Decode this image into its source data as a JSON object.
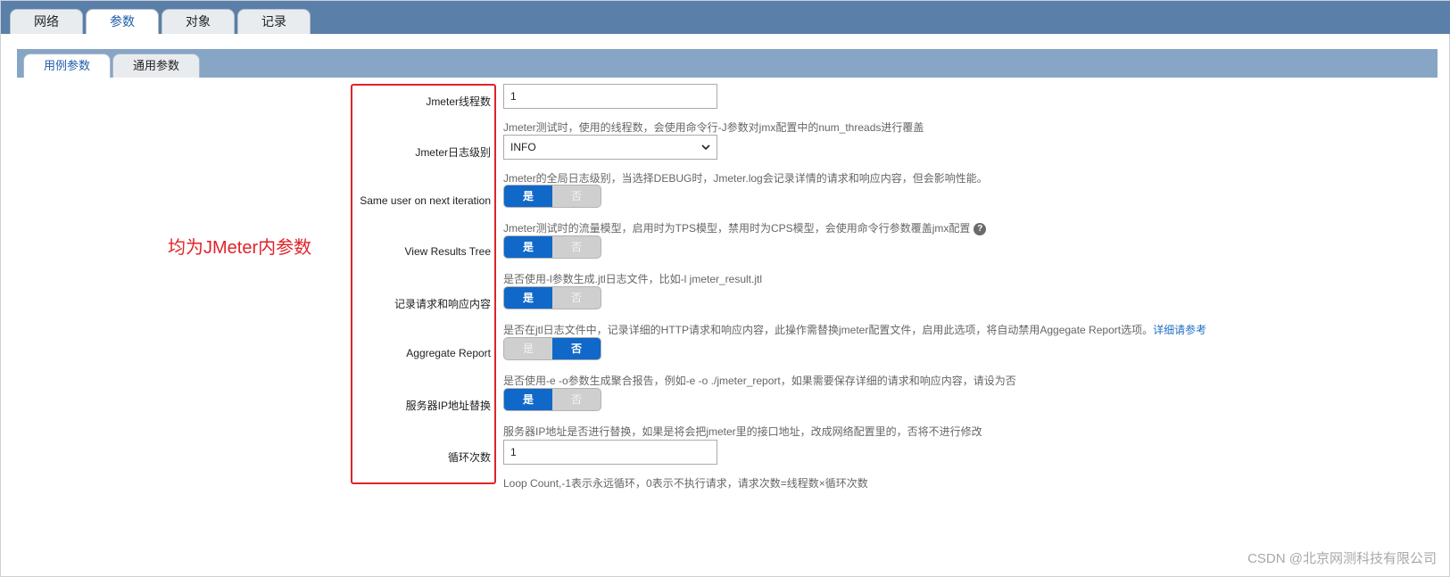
{
  "top_tabs": [
    {
      "label": "网络",
      "active": false
    },
    {
      "label": "参数",
      "active": true
    },
    {
      "label": "对象",
      "active": false
    },
    {
      "label": "记录",
      "active": false
    }
  ],
  "sub_tabs": [
    {
      "label": "用例参数",
      "active": true
    },
    {
      "label": "通用参数",
      "active": false
    }
  ],
  "form": {
    "threads": {
      "label": "Jmeter线程数",
      "value": "1",
      "help": "Jmeter测试时，使用的线程数，会使用命令行-J参数对jmx配置中的num_threads进行覆盖"
    },
    "log_level": {
      "label": "Jmeter日志级别",
      "value": "INFO",
      "help": "Jmeter的全局日志级别，当选择DEBUG时，Jmeter.log会记录详情的请求和响应内容，但会影响性能。"
    },
    "same_user": {
      "label": "Same user on next iteration",
      "yes": "是",
      "no": "否",
      "selected": "是",
      "help": "Jmeter测试时的流量模型，启用时为TPS模型，禁用时为CPS模型，会使用命令行参数覆盖jmx配置"
    },
    "view_results_tree": {
      "label": "View Results Tree",
      "yes": "是",
      "no": "否",
      "selected": "是",
      "help": "是否使用-l参数生成.jtl日志文件，比如-l jmeter_result.jtl"
    },
    "record_req_resp": {
      "label": "记录请求和响应内容",
      "yes": "是",
      "no": "否",
      "selected": "是",
      "help": "是否在jtl日志文件中，记录详细的HTTP请求和响应内容，此操作需替换jmeter配置文件，启用此选项，将自动禁用Aggegate Report选项。",
      "link": "详细请参考"
    },
    "aggregate_report": {
      "label": "Aggregate Report",
      "yes": "是",
      "no": "否",
      "selected": "否",
      "help": "是否使用-e -o参数生成聚合报告，例如-e -o ./jmeter_report，如果需要保存详细的请求和响应内容，请设为否"
    },
    "server_ip_replace": {
      "label": "服务器IP地址替换",
      "yes": "是",
      "no": "否",
      "selected": "是",
      "help": "服务器IP地址是否进行替换，如果是将会把jmeter里的接口地址，改成网络配置里的，否将不进行修改"
    },
    "loop_count": {
      "label": "循环次数",
      "value": "1",
      "help": "Loop Count,-1表示永远循环，0表示不执行请求，请求次数=线程数×循环次数"
    }
  },
  "help_icon_glyph": "?",
  "annotation": "均为JMeter内参数",
  "watermark": "CSDN @北京网测科技有限公司",
  "colors": {
    "top_bar": "#5a7fa8",
    "sub_bar": "#87a5c5",
    "toggle_on": "#1068c8",
    "annotation_red": "#e0232a",
    "link": "#1f6fc4"
  },
  "icons": {
    "select_arrow": "chevron-down-icon",
    "help": "question-circle-icon"
  }
}
